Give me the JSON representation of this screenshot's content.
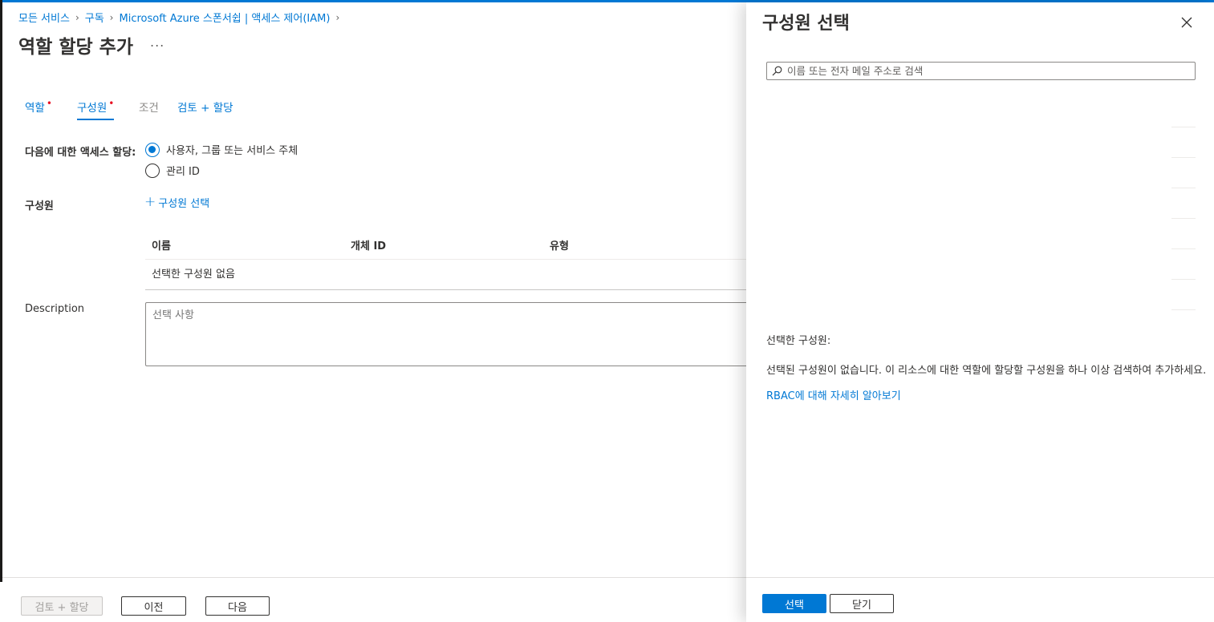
{
  "breadcrumb": [
    "모든 서비스",
    "구독",
    "Microsoft Azure 스폰서쉽 | 액세스 제어(IAM)"
  ],
  "page": {
    "title": "역할 할당 추가",
    "more": "..."
  },
  "tabs": [
    {
      "label": "역할",
      "required": "•"
    },
    {
      "label": "구성원",
      "required": "•"
    },
    {
      "label": "조건"
    },
    {
      "label": "검토 + 할당"
    }
  ],
  "assign_access": {
    "label": "다음에 대한 액세스 할당:",
    "options": [
      {
        "label": "사용자, 그룹 또는 서비스 주체",
        "selected": true
      },
      {
        "label": "관리 ID",
        "selected": false
      }
    ]
  },
  "members": {
    "label": "구성원",
    "add_link": "구성원 선택",
    "columns": [
      "이름",
      "개체 ID",
      "유형"
    ],
    "empty_text": "선택한 구성원 없음"
  },
  "description": {
    "label": "Description",
    "placeholder": "선택 사항"
  },
  "footer": {
    "review_label": "검토 + 할당",
    "prev_label": "이전",
    "next_label": "다음"
  },
  "panel": {
    "title": "구성원 선택",
    "search_placeholder": "이름 또는 전자 메일 주소로 검색",
    "selected_label": "선택한 구성원:",
    "empty_message": "선택된 구성원이 없습니다. 이 리소스에 대한 역할에 할당할 구성원을 하나 이상 검색하여 추가하세요.",
    "rbac_link": "RBAC에 대해 자세히 알아보기",
    "select_label": "선택",
    "close_label": "닫기"
  },
  "colors": {
    "accent": "#0078d4",
    "required": "#e81123",
    "text": "#323130"
  }
}
